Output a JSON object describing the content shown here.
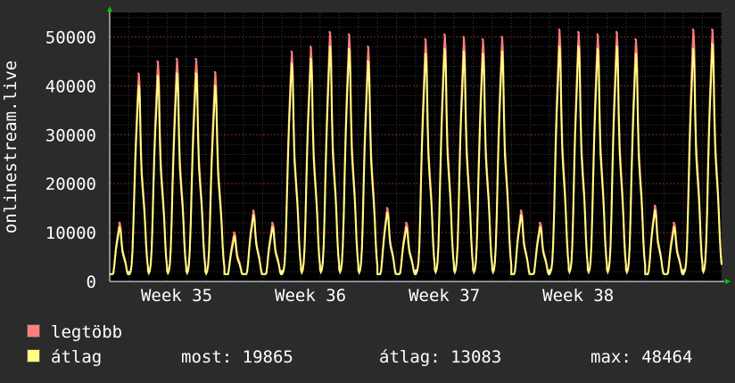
{
  "chart_data": {
    "type": "area",
    "title": "",
    "ylabel": "onlinestream.live",
    "xlabel": "",
    "ylim": [
      0,
      55000
    ],
    "y_ticks": [
      0,
      10000,
      20000,
      30000,
      40000,
      50000
    ],
    "y_tick_labels": [
      "0",
      "10000",
      "20000",
      "30000",
      "40000",
      "50000"
    ],
    "x_ticks": [
      "Week 35",
      "Week 36",
      "Week 37",
      "Week 38"
    ],
    "grid": true,
    "legend_placement": "bottom-left",
    "day_count": 30,
    "series": [
      {
        "name": "legtöbb",
        "color": "#ff7f7f",
        "values": [
          12000,
          42500,
          45000,
          45500,
          45500,
          42800,
          10000,
          14500,
          12000,
          47000,
          48000,
          51000,
          50500,
          48000,
          15000,
          12000,
          49500,
          50500,
          50000,
          49500,
          50000,
          14500,
          12000,
          51500,
          51000,
          50500,
          51000,
          49500,
          15500,
          12000,
          51500,
          51500
        ]
      },
      {
        "name": "átlag",
        "color": "#ffff80",
        "values": [
          11000,
          40000,
          42000,
          42500,
          42500,
          40000,
          9000,
          13500,
          11000,
          44500,
          45500,
          48000,
          47500,
          45000,
          14000,
          11000,
          46500,
          47500,
          47000,
          46500,
          47000,
          13500,
          11000,
          48000,
          48000,
          47500,
          48000,
          46500,
          14500,
          11000,
          47500,
          48500
        ]
      }
    ],
    "stats": {
      "most_label": "most:",
      "most_value": "19865",
      "atlag_label": "átlag:",
      "atlag_value": "13083",
      "max_label": "max:",
      "max_value": "48464"
    }
  },
  "colors": {
    "background": "#2b2b2b",
    "plot_background": "#000000",
    "grid_major": "#7a2a2a",
    "grid_minor": "#3a3a3a",
    "axis_arrow": "#00cc00",
    "text": "#ffffff",
    "max_series": "#ff7f7f",
    "avg_series": "#ffff80"
  }
}
